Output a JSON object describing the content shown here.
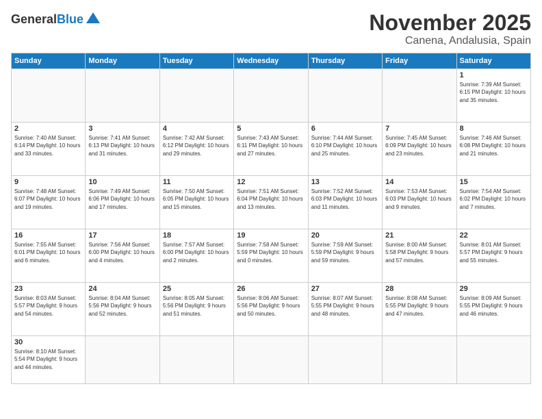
{
  "logo": {
    "general": "General",
    "blue": "Blue",
    "tagline": ""
  },
  "title": {
    "month": "November 2025",
    "location": "Canena, Andalusia, Spain"
  },
  "weekdays": [
    "Sunday",
    "Monday",
    "Tuesday",
    "Wednesday",
    "Thursday",
    "Friday",
    "Saturday"
  ],
  "weeks": [
    [
      {
        "day": "",
        "info": ""
      },
      {
        "day": "",
        "info": ""
      },
      {
        "day": "",
        "info": ""
      },
      {
        "day": "",
        "info": ""
      },
      {
        "day": "",
        "info": ""
      },
      {
        "day": "",
        "info": ""
      },
      {
        "day": "1",
        "info": "Sunrise: 7:39 AM\nSunset: 6:15 PM\nDaylight: 10 hours\nand 35 minutes."
      }
    ],
    [
      {
        "day": "2",
        "info": "Sunrise: 7:40 AM\nSunset: 6:14 PM\nDaylight: 10 hours\nand 33 minutes."
      },
      {
        "day": "3",
        "info": "Sunrise: 7:41 AM\nSunset: 6:13 PM\nDaylight: 10 hours\nand 31 minutes."
      },
      {
        "day": "4",
        "info": "Sunrise: 7:42 AM\nSunset: 6:12 PM\nDaylight: 10 hours\nand 29 minutes."
      },
      {
        "day": "5",
        "info": "Sunrise: 7:43 AM\nSunset: 6:11 PM\nDaylight: 10 hours\nand 27 minutes."
      },
      {
        "day": "6",
        "info": "Sunrise: 7:44 AM\nSunset: 6:10 PM\nDaylight: 10 hours\nand 25 minutes."
      },
      {
        "day": "7",
        "info": "Sunrise: 7:45 AM\nSunset: 6:09 PM\nDaylight: 10 hours\nand 23 minutes."
      },
      {
        "day": "8",
        "info": "Sunrise: 7:46 AM\nSunset: 6:08 PM\nDaylight: 10 hours\nand 21 minutes."
      }
    ],
    [
      {
        "day": "9",
        "info": "Sunrise: 7:48 AM\nSunset: 6:07 PM\nDaylight: 10 hours\nand 19 minutes."
      },
      {
        "day": "10",
        "info": "Sunrise: 7:49 AM\nSunset: 6:06 PM\nDaylight: 10 hours\nand 17 minutes."
      },
      {
        "day": "11",
        "info": "Sunrise: 7:50 AM\nSunset: 6:05 PM\nDaylight: 10 hours\nand 15 minutes."
      },
      {
        "day": "12",
        "info": "Sunrise: 7:51 AM\nSunset: 6:04 PM\nDaylight: 10 hours\nand 13 minutes."
      },
      {
        "day": "13",
        "info": "Sunrise: 7:52 AM\nSunset: 6:03 PM\nDaylight: 10 hours\nand 11 minutes."
      },
      {
        "day": "14",
        "info": "Sunrise: 7:53 AM\nSunset: 6:03 PM\nDaylight: 10 hours\nand 9 minutes."
      },
      {
        "day": "15",
        "info": "Sunrise: 7:54 AM\nSunset: 6:02 PM\nDaylight: 10 hours\nand 7 minutes."
      }
    ],
    [
      {
        "day": "16",
        "info": "Sunrise: 7:55 AM\nSunset: 6:01 PM\nDaylight: 10 hours\nand 6 minutes."
      },
      {
        "day": "17",
        "info": "Sunrise: 7:56 AM\nSunset: 6:00 PM\nDaylight: 10 hours\nand 4 minutes."
      },
      {
        "day": "18",
        "info": "Sunrise: 7:57 AM\nSunset: 6:00 PM\nDaylight: 10 hours\nand 2 minutes."
      },
      {
        "day": "19",
        "info": "Sunrise: 7:58 AM\nSunset: 5:59 PM\nDaylight: 10 hours\nand 0 minutes."
      },
      {
        "day": "20",
        "info": "Sunrise: 7:59 AM\nSunset: 5:59 PM\nDaylight: 9 hours\nand 59 minutes."
      },
      {
        "day": "21",
        "info": "Sunrise: 8:00 AM\nSunset: 5:58 PM\nDaylight: 9 hours\nand 57 minutes."
      },
      {
        "day": "22",
        "info": "Sunrise: 8:01 AM\nSunset: 5:57 PM\nDaylight: 9 hours\nand 55 minutes."
      }
    ],
    [
      {
        "day": "23",
        "info": "Sunrise: 8:03 AM\nSunset: 5:57 PM\nDaylight: 9 hours\nand 54 minutes."
      },
      {
        "day": "24",
        "info": "Sunrise: 8:04 AM\nSunset: 5:56 PM\nDaylight: 9 hours\nand 52 minutes."
      },
      {
        "day": "25",
        "info": "Sunrise: 8:05 AM\nSunset: 5:56 PM\nDaylight: 9 hours\nand 51 minutes."
      },
      {
        "day": "26",
        "info": "Sunrise: 8:06 AM\nSunset: 5:56 PM\nDaylight: 9 hours\nand 50 minutes."
      },
      {
        "day": "27",
        "info": "Sunrise: 8:07 AM\nSunset: 5:55 PM\nDaylight: 9 hours\nand 48 minutes."
      },
      {
        "day": "28",
        "info": "Sunrise: 8:08 AM\nSunset: 5:55 PM\nDaylight: 9 hours\nand 47 minutes."
      },
      {
        "day": "29",
        "info": "Sunrise: 8:09 AM\nSunset: 5:55 PM\nDaylight: 9 hours\nand 46 minutes."
      }
    ],
    [
      {
        "day": "30",
        "info": "Sunrise: 8:10 AM\nSunset: 5:54 PM\nDaylight: 9 hours\nand 44 minutes."
      },
      {
        "day": "",
        "info": ""
      },
      {
        "day": "",
        "info": ""
      },
      {
        "day": "",
        "info": ""
      },
      {
        "day": "",
        "info": ""
      },
      {
        "day": "",
        "info": ""
      },
      {
        "day": "",
        "info": ""
      }
    ]
  ]
}
